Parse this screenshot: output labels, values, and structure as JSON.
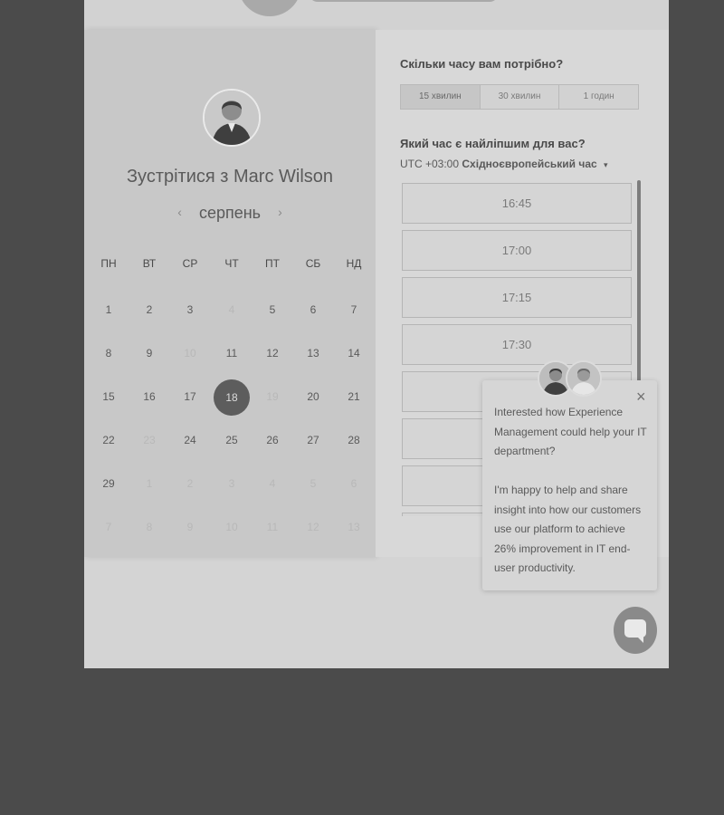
{
  "booking": {
    "meet_title": "Зустрітися з Marc Wilson",
    "month": "серпень",
    "weekdays": [
      "ПН",
      "ВТ",
      "СР",
      "ЧТ",
      "ПТ",
      "СБ",
      "НД"
    ],
    "weeks": [
      [
        "1",
        "2",
        "3",
        "4",
        "5",
        "6",
        "7"
      ],
      [
        "8",
        "9",
        "10",
        "11",
        "12",
        "13",
        "14"
      ],
      [
        "15",
        "16",
        "17",
        "18",
        "19",
        "20",
        "21"
      ],
      [
        "22",
        "23",
        "24",
        "25",
        "26",
        "27",
        "28"
      ],
      [
        "29",
        "1",
        "2",
        "3",
        "4",
        "5",
        "6"
      ],
      [
        "7",
        "8",
        "9",
        "10",
        "11",
        "12",
        "13"
      ]
    ],
    "selected_day": "18"
  },
  "duration": {
    "question": "Скільки часу вам потрібно?",
    "options": [
      "15 хвилин",
      "30 хвилин",
      "1 годин"
    ],
    "selected": "15 хвилин"
  },
  "times": {
    "question": "Який час є найліпшим для вас?",
    "tz_offset": "UTC +03:00",
    "tz_name": "Східноєвропейський час",
    "slots": [
      "16:45",
      "17:00",
      "17:15",
      "17:30",
      "",
      "",
      "",
      ""
    ]
  },
  "chat": {
    "message_1": "Interested how Experience Management could help your IT department?",
    "message_2": "I'm happy to help and share insight into how our customers use our platform to achieve 26% improvement in IT end-user productivity.",
    "close_icon": "×"
  }
}
